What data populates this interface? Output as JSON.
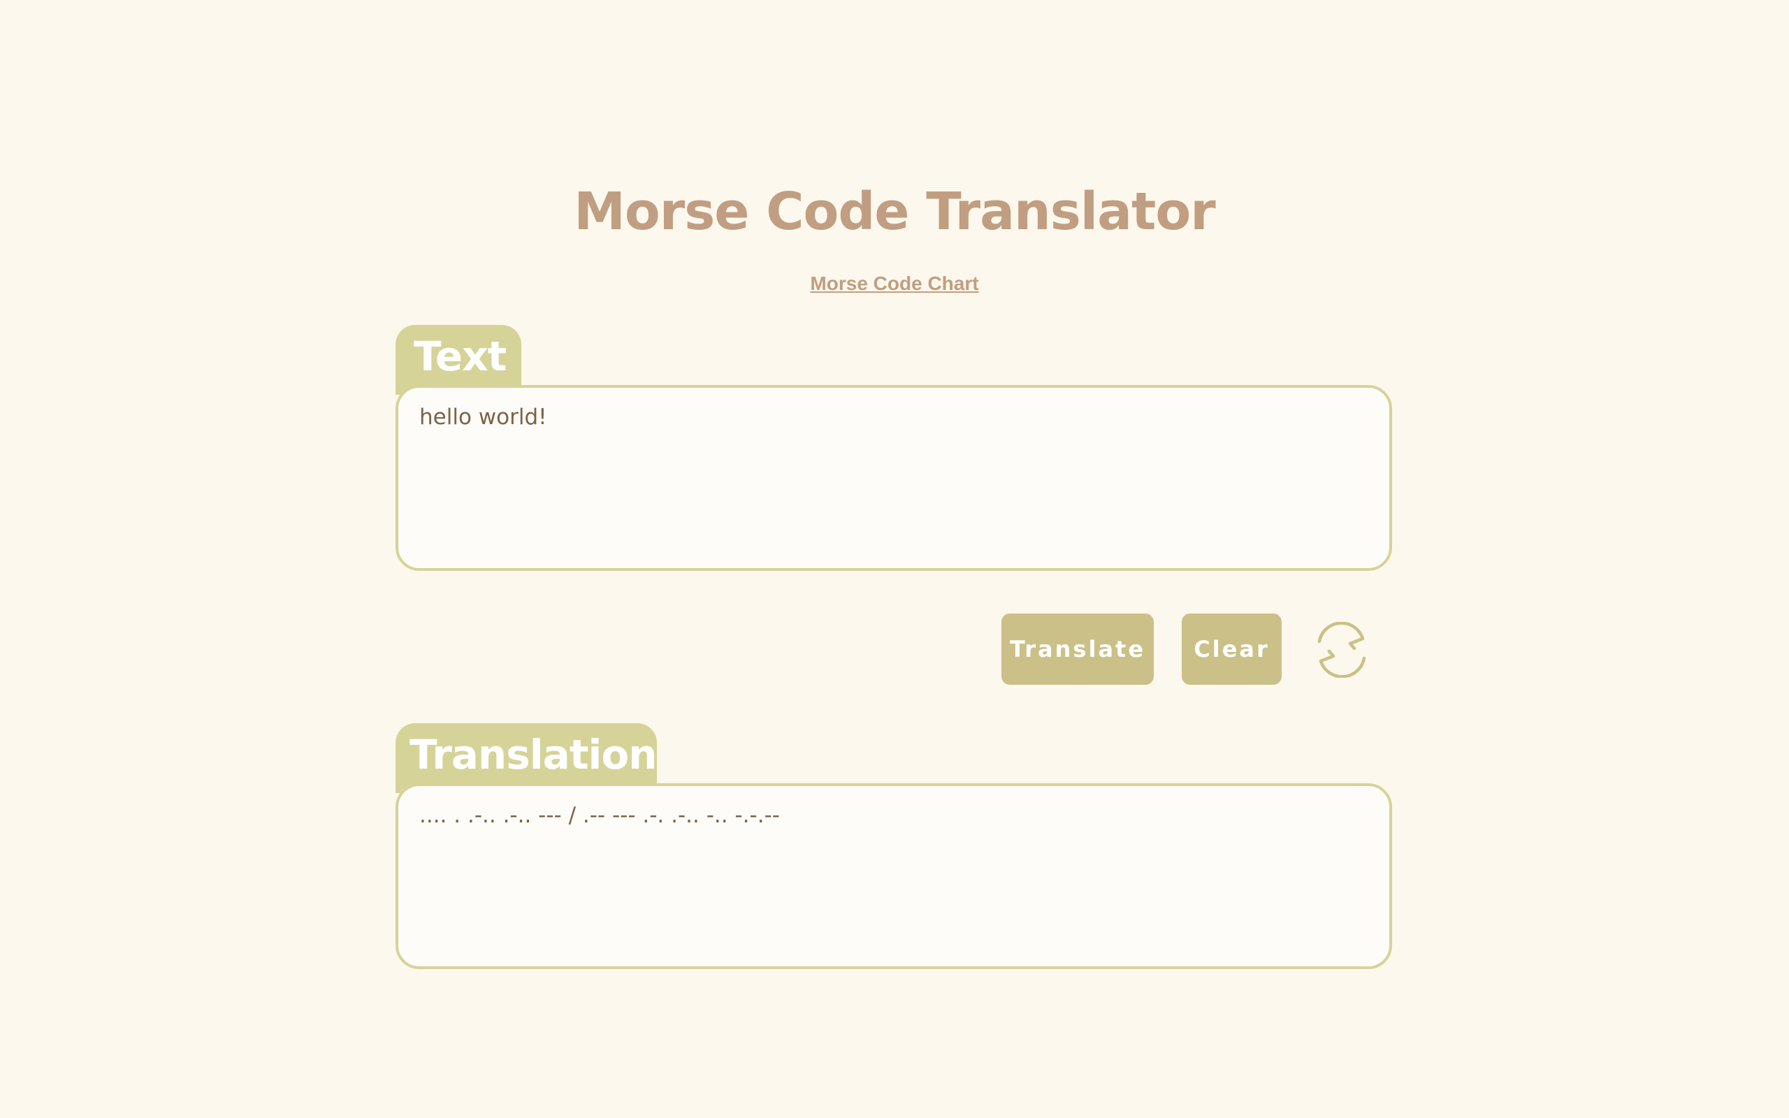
{
  "page": {
    "title": "Morse Code Translator",
    "chart_link": "Morse Code Chart"
  },
  "input": {
    "tab_label": "Text",
    "value": "hello world!"
  },
  "actions": {
    "translate_label": "Translate",
    "clear_label": "Clear",
    "swap_icon": "swap-arrows-icon"
  },
  "output": {
    "tab_label": "Translation",
    "value": ".... . .-.. .-.. --- / .-- --- .-. .-.. -.. -.-.--"
  },
  "colors": {
    "background": "#fcf8ed",
    "title": "#c19e81",
    "tab": "#d6d398",
    "button": "#cbc087",
    "box_text": "#7d6247"
  }
}
